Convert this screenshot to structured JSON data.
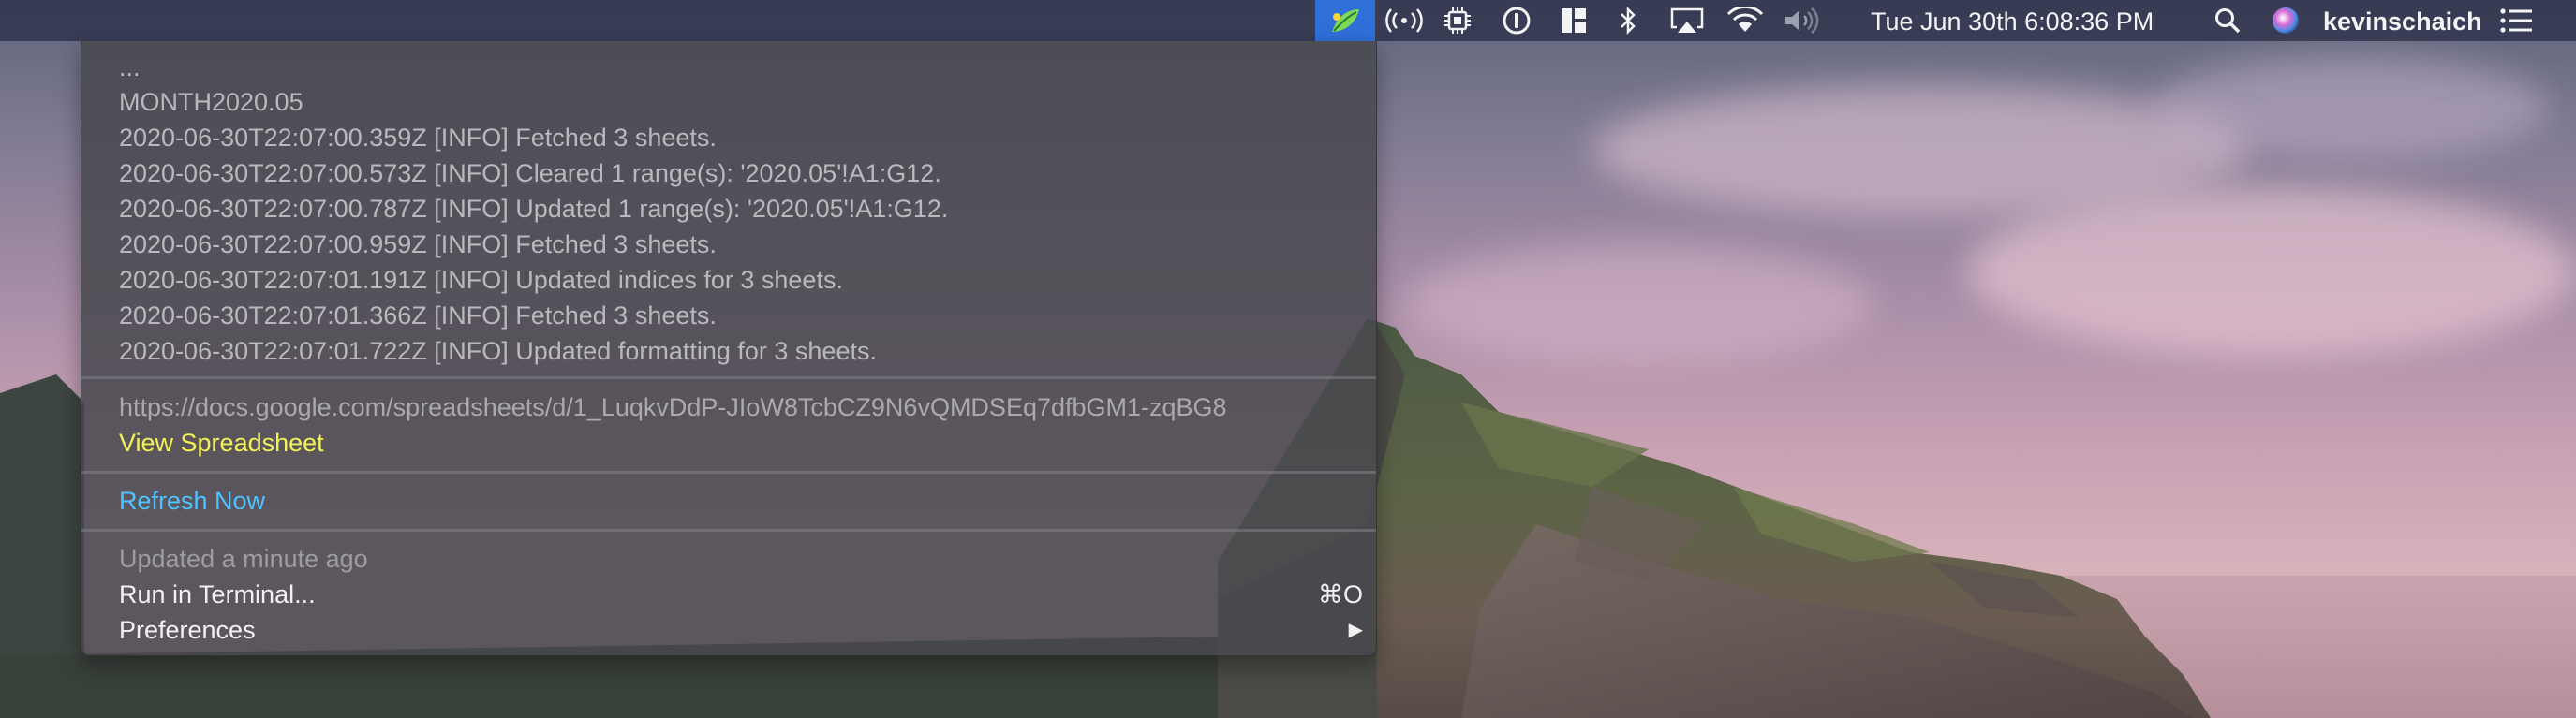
{
  "menubar": {
    "status_items": [
      {
        "name": "broadcast",
        "glyph": "((•))"
      },
      {
        "name": "cpu",
        "glyph": "▦"
      },
      {
        "name": "1password",
        "glyph": "⓪"
      },
      {
        "name": "window-manager",
        "glyph": "▙"
      },
      {
        "name": "bluetooth",
        "glyph": "ᛒ"
      },
      {
        "name": "airplay",
        "glyph": "▭"
      },
      {
        "name": "wifi",
        "glyph": "◠"
      },
      {
        "name": "volume",
        "glyph": "🔈"
      }
    ],
    "clock": "Tue Jun 30th 6:08:36 PM",
    "username": "kevinschaich"
  },
  "menu": {
    "log_lines": [
      "...",
      "MONTH2020.05",
      "2020-06-30T22:07:00.359Z [INFO] Fetched 3 sheets.",
      "2020-06-30T22:07:00.573Z [INFO] Cleared 1 range(s): '2020.05'!A1:G12.",
      "2020-06-30T22:07:00.787Z [INFO] Updated 1 range(s): '2020.05'!A1:G12.",
      "2020-06-30T22:07:00.959Z [INFO] Fetched 3 sheets.",
      "2020-06-30T22:07:01.191Z [INFO] Updated indices for 3 sheets.",
      "2020-06-30T22:07:01.366Z [INFO] Fetched 3 sheets.",
      "2020-06-30T22:07:01.722Z [INFO] Updated formatting for 3 sheets."
    ],
    "spreadsheet_url": "https://docs.google.com/spreadsheets/d/1_LuqkvDdP-JIoW8TcbCZ9N6vQMDSEq7dfbGM1-zqBG8",
    "view_spreadsheet": "View Spreadsheet",
    "refresh_now": "Refresh Now",
    "updated_status": "Updated a minute ago",
    "run_in_terminal": "Run in Terminal...",
    "run_in_terminal_shortcut": "⌘O",
    "preferences": "Preferences",
    "preferences_arrow": "▶"
  },
  "colors": {
    "menubar_bg": "#343850",
    "app_icon_bg": "#2f6fd8",
    "link_yellow": "#f2f15a",
    "link_blue": "#4ec3ff"
  }
}
